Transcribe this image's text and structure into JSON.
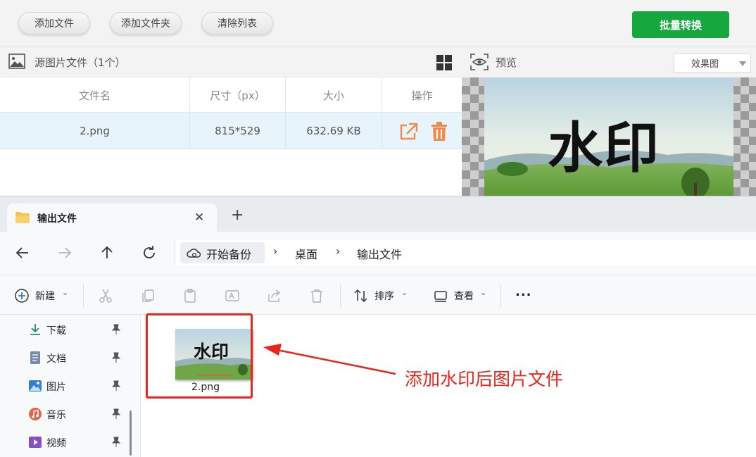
{
  "app": {
    "buttons": {
      "add_file": "添加文件",
      "add_folder": "添加文件夹",
      "clear_list": "清除列表",
      "batch_convert": "批量转换"
    },
    "source_title": "源图片文件（1个）",
    "columns": [
      "文件名",
      "尺寸（px）",
      "大小",
      "操作"
    ],
    "rows": [
      {
        "name": "2.png",
        "dimensions": "815*529",
        "size": "632.69 KB"
      }
    ],
    "preview": {
      "title": "预览",
      "mode": "效果图",
      "watermark": "水印"
    },
    "colors": {
      "accent_green": "#17a73f",
      "action_orange": "#f08c4a",
      "row_highlight": "#e8f4fc"
    }
  },
  "explorer": {
    "tab_title": "输出文件",
    "breadcrumb": [
      "开始备份",
      "桌面",
      "输出文件"
    ],
    "commands": {
      "new": "新建",
      "sort": "排序",
      "view": "查看",
      "more": "..."
    },
    "sidebar": [
      {
        "label": "下载",
        "icon": "download-icon"
      },
      {
        "label": "文档",
        "icon": "document-icon"
      },
      {
        "label": "图片",
        "icon": "pictures-icon"
      },
      {
        "label": "音乐",
        "icon": "music-icon"
      },
      {
        "label": "视频",
        "icon": "video-icon"
      }
    ],
    "files": [
      {
        "name": "2.png",
        "watermark": "水印"
      }
    ]
  },
  "annotation": {
    "text": "添加水印后图片文件",
    "color": "#e8261c"
  }
}
